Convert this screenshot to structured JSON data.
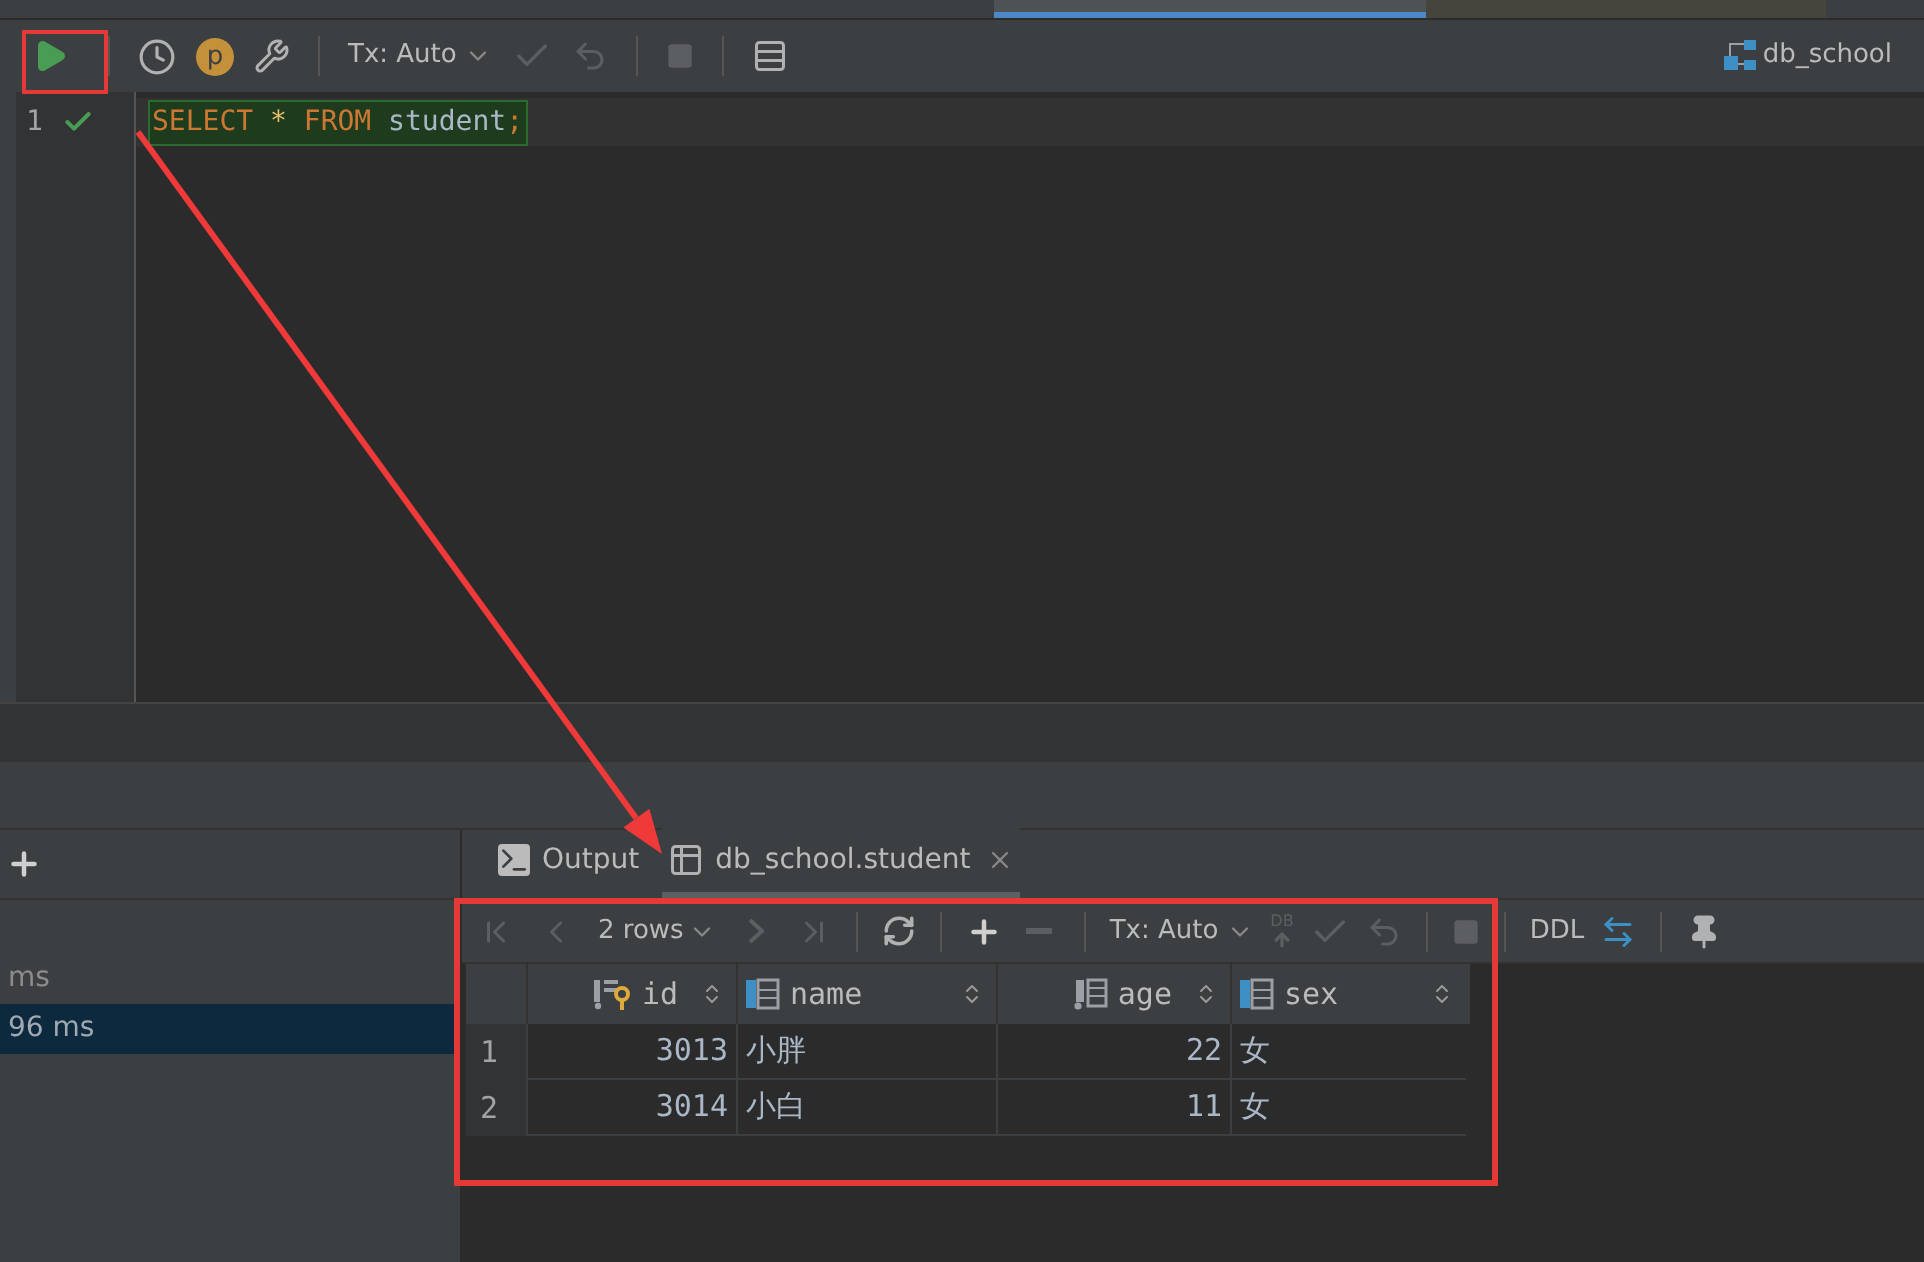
{
  "toolbar": {
    "profile_badge": "p",
    "tx_mode": "Tx: Auto",
    "schema": "db_school"
  },
  "editor": {
    "lines": [
      {
        "number": "1",
        "succeeded": true,
        "tokens": [
          {
            "kind": "keyword",
            "text": "SELECT"
          },
          {
            "kind": "operator",
            "text": "*"
          },
          {
            "kind": "keyword",
            "text": "FROM"
          },
          {
            "kind": "identifier",
            "text": "student"
          },
          {
            "kind": "punct",
            "text": ";"
          }
        ]
      }
    ]
  },
  "history": {
    "items": [
      {
        "text": "ms",
        "selected": false
      },
      {
        "text": "96 ms",
        "selected": true
      }
    ]
  },
  "bottom_tabs": [
    {
      "label": "Output",
      "kind": "console",
      "selected": false,
      "closable": false
    },
    {
      "label": "db_school.student",
      "kind": "table",
      "selected": true,
      "closable": true
    }
  ],
  "results": {
    "page_size": "2 rows",
    "tx_mode": "Tx: Auto",
    "db_badge": "DB",
    "ddl": "DDL",
    "columns": [
      {
        "name": "id",
        "kind": "key"
      },
      {
        "name": "name",
        "kind": "plain"
      },
      {
        "name": "age",
        "kind": "indexed"
      },
      {
        "name": "sex",
        "kind": "plain"
      }
    ],
    "rows": [
      {
        "number": "1",
        "cells": [
          "3013",
          "小胖",
          "22",
          "女"
        ]
      },
      {
        "number": "2",
        "cells": [
          "3014",
          "小白",
          "11",
          "女"
        ]
      }
    ]
  }
}
